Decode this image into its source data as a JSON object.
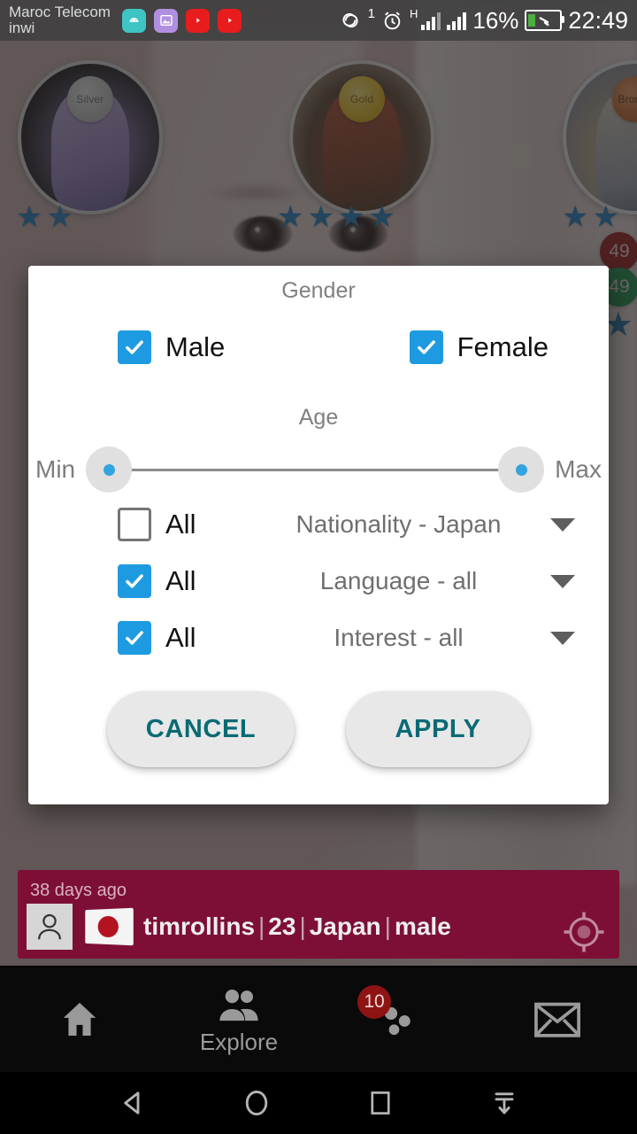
{
  "status_bar": {
    "carrier_line1": "Maroc Telecom",
    "carrier_line2": "inwi",
    "app_icons": [
      "android-icon",
      "gallery-icon",
      "youtube-icon",
      "youtube-icon"
    ],
    "sync_count": "1",
    "network_type": "H",
    "battery_percent": "16%",
    "clock": "22:49"
  },
  "background": {
    "cards": [
      {
        "badge": "Silver",
        "badge_class": "silver",
        "stars": 2
      },
      {
        "badge": "Gold",
        "badge_class": "gold",
        "stars": 4
      },
      {
        "badge": "Bronze",
        "badge_class": "bronze",
        "stars": 2
      }
    ],
    "side_badges": [
      {
        "label": "49",
        "color": "#9c1414"
      },
      {
        "label": "49",
        "color": "#12924a"
      }
    ]
  },
  "dialog": {
    "gender_title": "Gender",
    "gender_options": [
      {
        "label": "Male",
        "checked": true
      },
      {
        "label": "Female",
        "checked": true
      }
    ],
    "age_title": "Age",
    "age_min_label": "Min",
    "age_max_label": "Max",
    "filters": [
      {
        "all_label": "All",
        "value": "Nationality - Japan",
        "checked": false
      },
      {
        "all_label": "All",
        "value": "Language - all",
        "checked": true
      },
      {
        "all_label": "All",
        "value": "Interest - all",
        "checked": true
      }
    ],
    "cancel_label": "CANCEL",
    "apply_label": "APPLY",
    "accent_color": "#1e9be0",
    "button_text_color": "#0a6a74"
  },
  "user_strip": {
    "time_ago": "38 days ago",
    "username": "timrollins",
    "age": "23",
    "country": "Japan",
    "gender": "male",
    "separator": "|",
    "background_color": "#7d0f37"
  },
  "bottom_nav": {
    "items": [
      {
        "icon": "home-icon",
        "label": ""
      },
      {
        "icon": "people-icon",
        "label": "Explore"
      },
      {
        "icon": "chat-bubbles-icon",
        "label": "",
        "badge": "10"
      },
      {
        "icon": "envelope-icon",
        "label": ""
      }
    ]
  },
  "android_nav": {
    "buttons": [
      "back-icon",
      "home-circle-icon",
      "recents-square-icon",
      "hide-navbar-icon"
    ]
  }
}
